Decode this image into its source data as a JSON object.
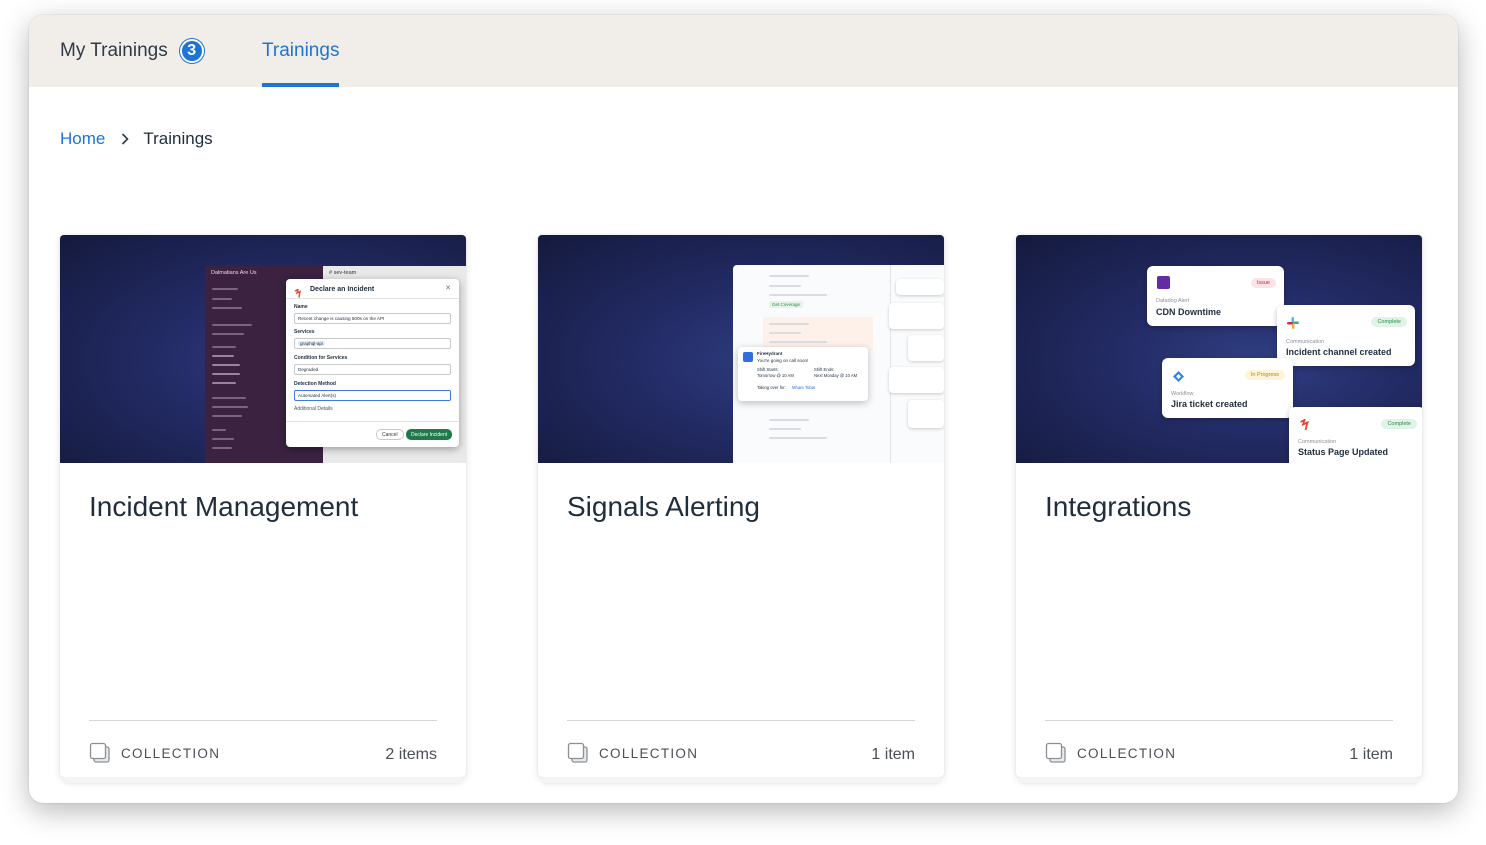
{
  "tabs": {
    "my_trainings_label": "My Trainings",
    "my_trainings_count": "3",
    "trainings_label": "Trainings"
  },
  "breadcrumb": {
    "home": "Home",
    "current": "Trainings"
  },
  "colors": {
    "accent": "#1c74d9",
    "tabbar_bg": "#f1eeea",
    "thumb_bg": "#222a63"
  },
  "cards": [
    {
      "title": "Incident Management",
      "type_label": "COLLECTION",
      "count": "2 items",
      "thumb": {
        "sidebar_title": "Dalmatians Are Us",
        "channel": "# sev-team",
        "dialog_title": "Declare an Incident",
        "name_label": "Name",
        "name_value": "Recent change is causing 500s on the API",
        "services_label": "Services",
        "service_chip": "graphql-api",
        "condition_label": "Condition for Services",
        "condition_value": "Degraded",
        "detection_label": "Detection Method",
        "detection_value": "Automated Alert(s)",
        "details_label": "Additional Details",
        "cancel": "Cancel",
        "declare": "Declare Incident"
      }
    },
    {
      "title": "Signals Alerting",
      "type_label": "COLLECTION",
      "count": "1 item",
      "thumb": {
        "coverage": "Get Coverage",
        "app_name": "FireHydrant",
        "message": "You're going on call soon!",
        "shift_starts_label": "Shift Starts:",
        "shift_starts_value": "Tomorrow @ 10 AM",
        "shift_ends_label": "Shift Ends:",
        "shift_ends_value": "Next Monday @ 10 AM",
        "taking_over": "Taking over for:",
        "taking_over_name": "Mhare Tobar"
      }
    },
    {
      "title": "Integrations",
      "type_label": "COLLECTION",
      "count": "1 item",
      "thumb": {
        "items": [
          {
            "source": "Datadog Alert",
            "title": "CDN Downtime",
            "status": "Issue"
          },
          {
            "source": "Communication",
            "title": "Incident channel created",
            "status": "Complete"
          },
          {
            "source": "Workflow",
            "title": "Jira ticket created",
            "status": "In Progress"
          },
          {
            "source": "Communication",
            "title": "Status Page Updated",
            "status": "Complete"
          }
        ]
      }
    }
  ]
}
